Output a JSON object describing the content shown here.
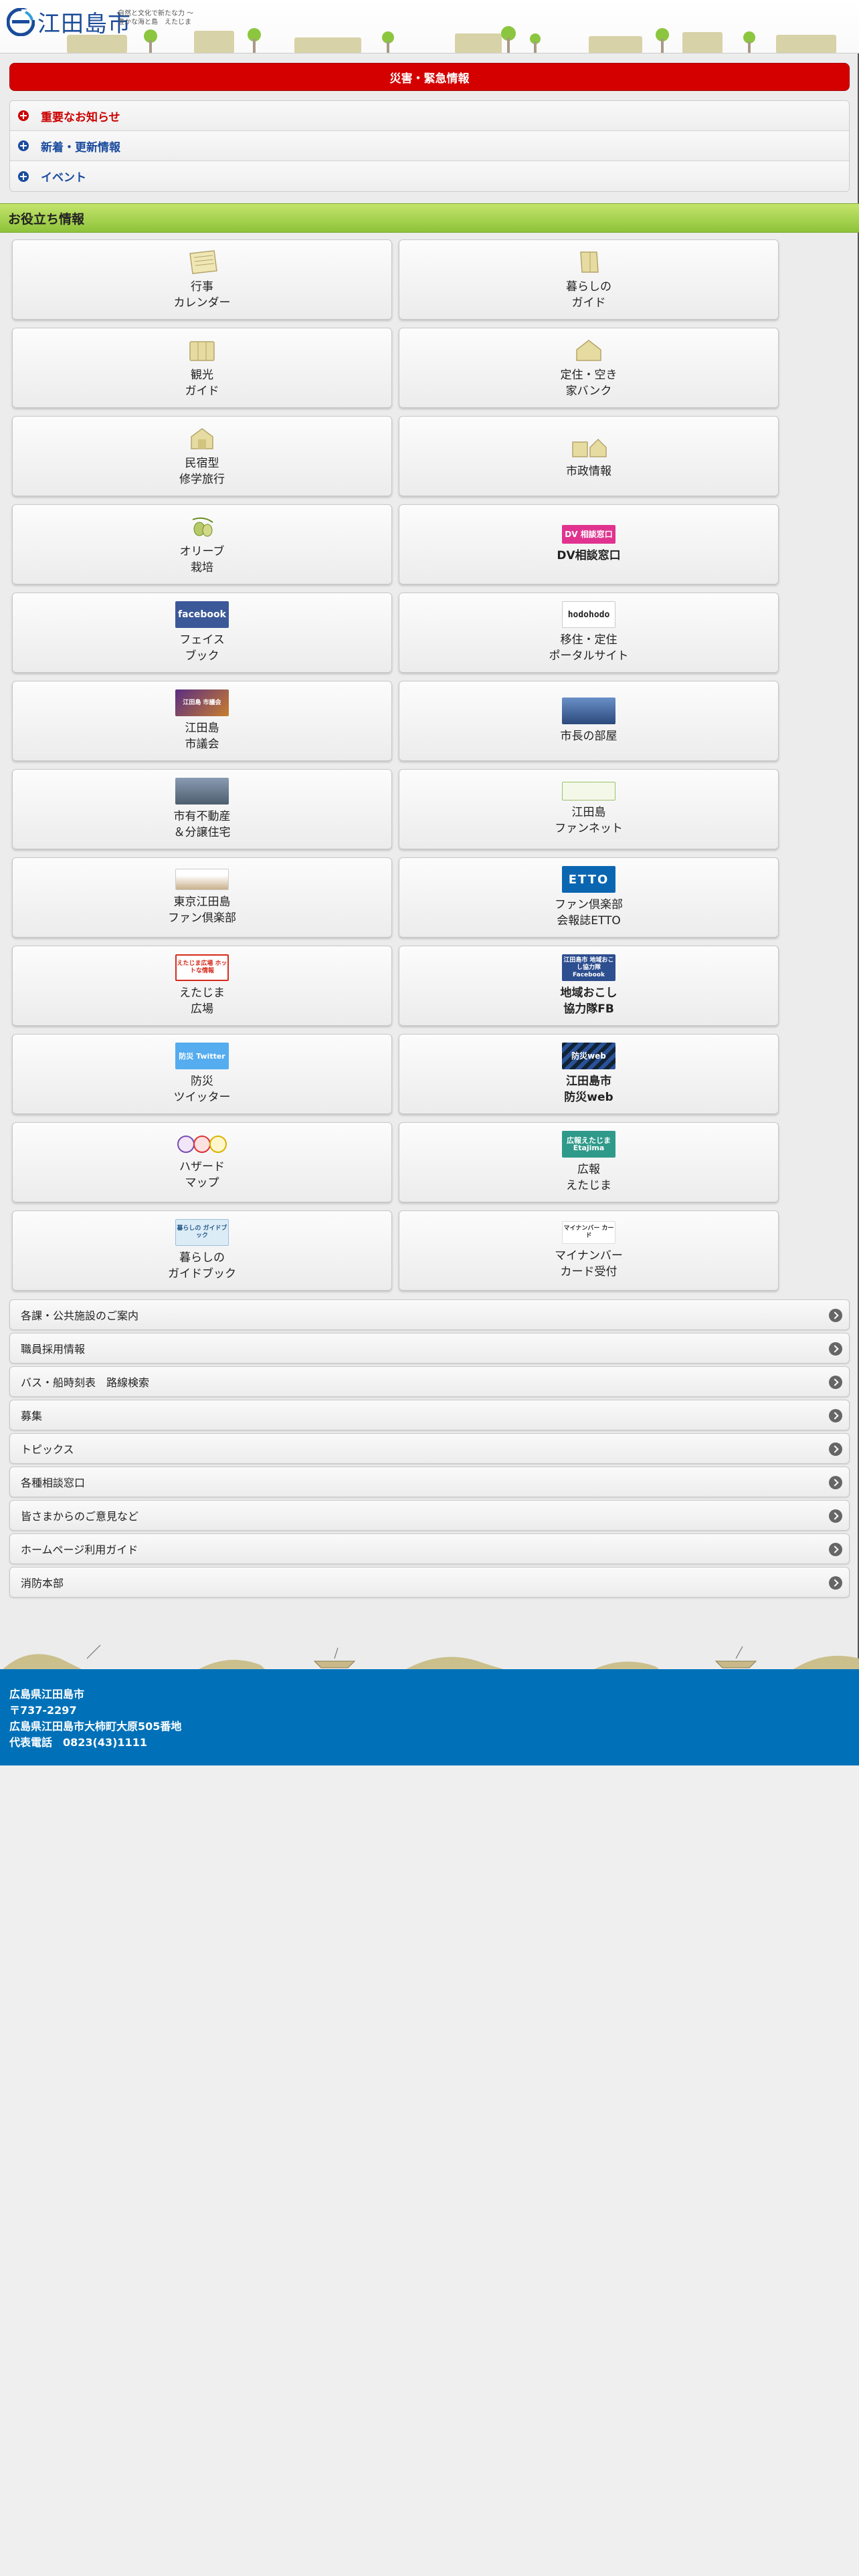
{
  "header": {
    "logo_text": "江田島市",
    "tagline": "自然と文化で新たな力 ～豊かな海と島　えたじま",
    "logo_mark": "etajima-e-logo"
  },
  "alert": {
    "label": "災害・緊急情報",
    "color": "#d40000"
  },
  "notices": [
    {
      "label": "重要なお知らせ",
      "color": "#cc0000"
    },
    {
      "label": "新着・更新情報",
      "color": "#1a4b9e"
    },
    {
      "label": "イベント",
      "color": "#1a4b9e"
    }
  ],
  "section": {
    "title": "お役立ち情報"
  },
  "tiles": [
    {
      "label": "行事\nカレンダー",
      "icon": "calendar-icon"
    },
    {
      "label": "暮らしの\nガイド",
      "icon": "guide-icon"
    },
    {
      "label": "観光\nガイド",
      "icon": "tourism-icon"
    },
    {
      "label": "定住・空き\n家バンク",
      "icon": "house-icon"
    },
    {
      "label": "民宿型\n修学旅行",
      "icon": "lodging-icon"
    },
    {
      "label": "市政情報",
      "icon": "city-hall-icon"
    },
    {
      "label": "オリーブ\n栽培",
      "icon": "olive-icon"
    },
    {
      "label": "DV相談窓口",
      "icon": "dv-banner",
      "banner": "DV 相談窓口",
      "bold": true
    },
    {
      "label": "フェイス\nブック",
      "icon": "facebook-banner",
      "banner": "facebook"
    },
    {
      "label": "移住・定住\nポータルサイト",
      "icon": "hodohodo-banner",
      "banner": "hodohodo"
    },
    {
      "label": "江田島\n市議会",
      "icon": "assembly-banner",
      "banner": "江田島 市議会"
    },
    {
      "label": "市長の部屋",
      "icon": "mayor-banner",
      "banner": ""
    },
    {
      "label": "市有不動産\n＆分譲住宅",
      "icon": "real-estate-banner",
      "banner": ""
    },
    {
      "label": "江田島\nファンネット",
      "icon": "fannet-banner",
      "banner": ""
    },
    {
      "label": "東京江田島\nファン倶楽部",
      "icon": "tokyo-fan-club-banner",
      "banner": ""
    },
    {
      "label": "ファン倶楽部\n会報誌ETTO",
      "icon": "etto-banner",
      "banner": "ETTO"
    },
    {
      "label": "えたじま\n広場",
      "icon": "hiroba-banner",
      "banner": "えたじま広場 ホットな情報"
    },
    {
      "label": "地域おこし\n協力隊FB",
      "icon": "chiiki-okoshi-banner",
      "banner": "江田島市 地域おこし協力隊 Facebook"
    },
    {
      "label": "防災\nツイッター",
      "icon": "bousai-twitter-banner",
      "banner": "防災 Twitter"
    },
    {
      "label": "江田島市\n防災web",
      "icon": "bousai-web-banner",
      "banner": "防災web"
    },
    {
      "label": "ハザード\nマップ",
      "icon": "hazard-map-icon",
      "banner": ""
    },
    {
      "label": "広報\nえたじま",
      "icon": "kouhou-banner",
      "banner": "広報えたじま Etajima"
    },
    {
      "label": "暮らしの\nガイドブック",
      "icon": "guidebook-banner",
      "banner": "暮らしの ガイドブック"
    },
    {
      "label": "マイナンバー\nカード受付",
      "icon": "mynumber-banner",
      "banner": "マイナンバー カード"
    }
  ],
  "links": [
    "各課・公共施設のご案内",
    "職員採用情報",
    "バス・船時刻表　路線検索",
    "募集",
    "トピックス",
    "各種相談窓口",
    "皆さまからのご意見など",
    "ホームページ利用ガイド",
    "消防本部"
  ],
  "footer": {
    "line1": "広島県江田島市",
    "line2": "〒737-2297",
    "line3": "広島県江田島市大柿町大原505番地",
    "line4": "代表電話　0823(43)1111",
    "color": "#0071b8"
  }
}
